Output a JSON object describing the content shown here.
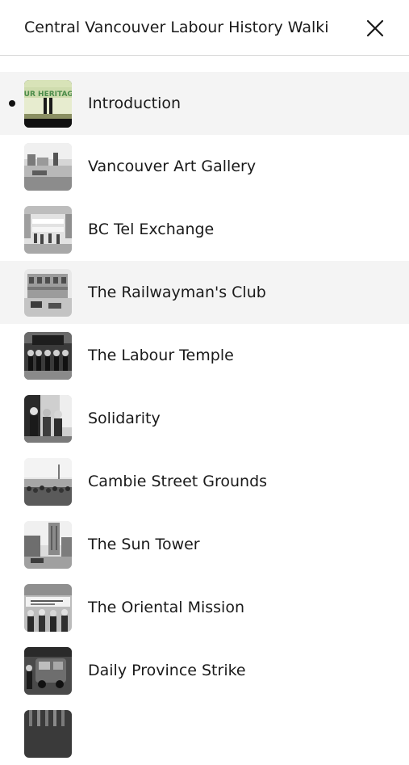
{
  "header": {
    "title": "Central Vancouver Labour History Walki",
    "close_icon": "close-icon"
  },
  "stops": [
    {
      "label": "Introduction",
      "thumb_text": "OUR HERITAGE"
    },
    {
      "label": "Vancouver Art Gallery"
    },
    {
      "label": "BC Tel Exchange"
    },
    {
      "label": "The Railwayman's Club"
    },
    {
      "label": "The Labour Temple"
    },
    {
      "label": "Solidarity"
    },
    {
      "label": "Cambie Street Grounds"
    },
    {
      "label": "The Sun Tower"
    },
    {
      "label": "The Oriental Mission"
    },
    {
      "label": "Daily Province Strike"
    }
  ],
  "current_index": 0,
  "colors": {
    "highlight_background": "#f4f4f4",
    "divider": "#d9d9d9",
    "current_marker": "#111111"
  }
}
